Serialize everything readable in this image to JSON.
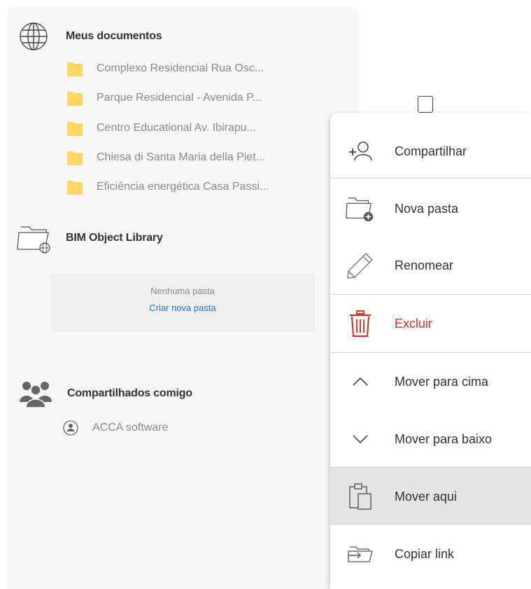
{
  "sidebar": {
    "my_documents": {
      "title": "Meus documentos",
      "icon": "globe-icon",
      "items": [
        {
          "label": "Complexo Residencial Rua Osc..."
        },
        {
          "label": "Parque Residencial - Avenida P..."
        },
        {
          "label": "Centro Educational Av. Ibirapu..."
        },
        {
          "label": "Chiesa di Santa Maria della Piet..."
        },
        {
          "label": "Eficiência energética Casa Passi..."
        }
      ]
    },
    "library": {
      "title": "BIM Object Library",
      "icon": "library-folder-icon",
      "empty_text": "Nenhuma pasta",
      "create_link": "Criar nova pasta"
    },
    "shared": {
      "title": "Compartilhados comigo",
      "icon": "users-icon",
      "items": [
        {
          "label": "ACCA software"
        }
      ]
    }
  },
  "context_menu": {
    "items": [
      {
        "label": "Compartilhar",
        "icon": "share-user-icon"
      },
      {
        "label": "Nova pasta",
        "icon": "new-folder-icon"
      },
      {
        "label": "Renomear",
        "icon": "pencil-icon"
      },
      {
        "label": "Excluir",
        "icon": "trash-icon"
      },
      {
        "label": "Mover para cima",
        "icon": "chevron-up-icon"
      },
      {
        "label": "Mover para baixo",
        "icon": "chevron-down-icon"
      },
      {
        "label": "Mover aqui",
        "icon": "paste-icon"
      },
      {
        "label": "Copiar link",
        "icon": "link-folder-icon"
      }
    ]
  },
  "colors": {
    "folder": "#ffd666",
    "danger": "#e0291c",
    "link": "#1e73d6",
    "active_bg": "#e4e4e4"
  }
}
